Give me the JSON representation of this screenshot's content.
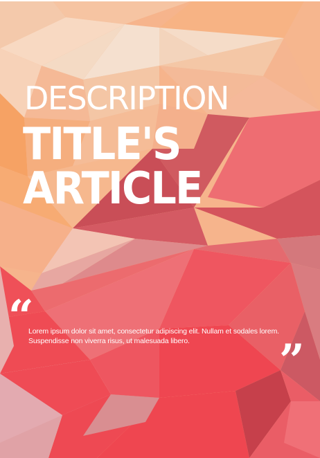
{
  "cover": {
    "description": "DESCRIPTION",
    "title_line1": "TITLE'S",
    "title_line2": "ARTICLE",
    "quote_open": "“",
    "quote_close": "”",
    "body": "Lorem ipsum dolor sit amet, consectetur adipiscing elit. Nullam et sodales lorem. Suspendisse non viverra risus, ut malesuada libero."
  },
  "palette": {
    "peach_light": "#f4cfb4",
    "peach": "#f5b88d",
    "orange": "#f6a56c",
    "rose": "#ee6f72",
    "red": "#ef4b55",
    "crimson": "#c94a55",
    "pink_muted": "#d98a8d"
  }
}
